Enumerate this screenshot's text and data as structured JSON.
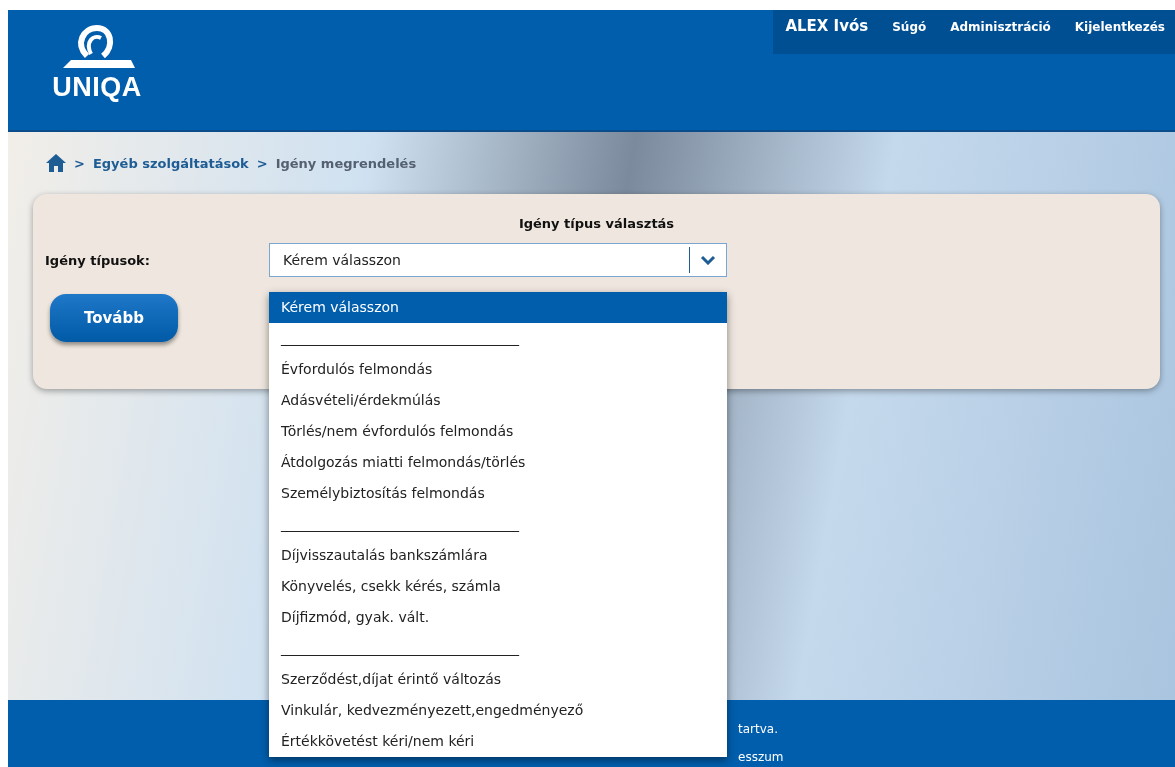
{
  "header": {
    "logo_text": "UNIQA",
    "user": "ALEX Ivós",
    "nav": [
      {
        "label": "Súgó"
      },
      {
        "label": "Adminisztráció"
      },
      {
        "label": "Kijelentkezés"
      }
    ]
  },
  "breadcrumb": [
    {
      "label": "Egyéb szolgáltatások",
      "kind": "link"
    },
    {
      "label": "Igény megrendelés",
      "kind": "current"
    }
  ],
  "breadcrumb_separator": ">",
  "form": {
    "title": "Igény típus választás",
    "label": "Igény típusok:",
    "select": {
      "value": "Kérem válasszon",
      "expanded": true,
      "options": [
        {
          "label": "Kérem válasszon",
          "selected": true
        },
        {
          "label": "__________________________________",
          "selected": false
        },
        {
          "label": "Évfordulós felmondás",
          "selected": false
        },
        {
          "label": "Adásvételi/érdekmúlás",
          "selected": false
        },
        {
          "label": "Törlés/nem évfordulós felmondás",
          "selected": false
        },
        {
          "label": "Átdolgozás miatti felmondás/törlés",
          "selected": false
        },
        {
          "label": "Személybiztosítás felmondás",
          "selected": false
        },
        {
          "label": "__________________________________",
          "selected": false
        },
        {
          "label": "Díjvisszautalás bankszámlára",
          "selected": false
        },
        {
          "label": "Könyvelés, csekk kérés, számla",
          "selected": false
        },
        {
          "label": "Díjfizmód, gyak. vált.",
          "selected": false
        },
        {
          "label": "__________________________________",
          "selected": false
        },
        {
          "label": "Szerződést,díjat érintő változás",
          "selected": false
        },
        {
          "label": "Vinkulár, kedvezményezett,engedményező",
          "selected": false
        },
        {
          "label": "Értékkövetést kéri/nem kéri",
          "selected": false
        }
      ]
    },
    "button": "Tovább"
  },
  "footer": {
    "lines": [
      "tartva.",
      "esszum"
    ]
  }
}
